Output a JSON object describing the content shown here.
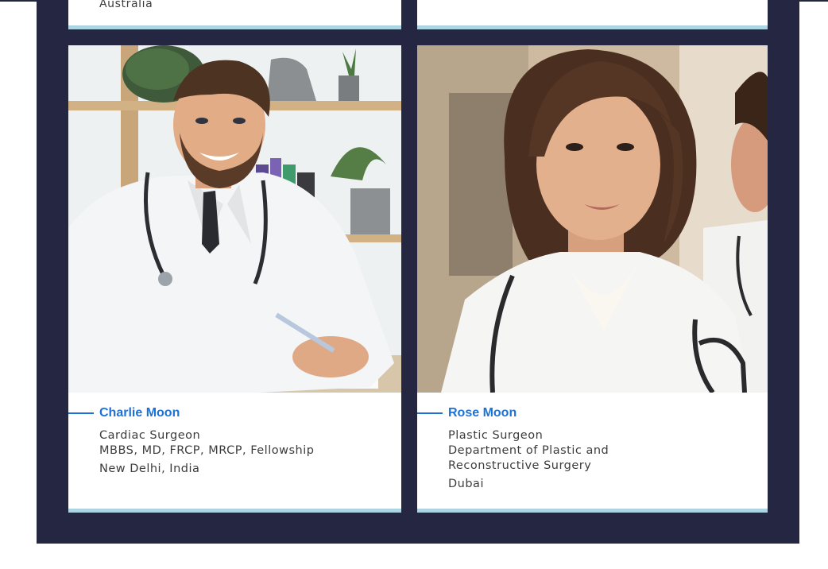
{
  "previous_row": {
    "left_location": "Australia"
  },
  "doctors": [
    {
      "name": "Charlie Moon",
      "specialty": "Cardiac Surgeon",
      "qualifications": "MBBS, MD, FRCP, MRCP, Fellowship",
      "location": "New Delhi, India",
      "photo_icon": "doctor-photo-male"
    },
    {
      "name": "Rose Moon",
      "specialty": "Plastic Surgeon",
      "department_line1": "Department of Plastic and",
      "department_line2": "Reconstructive Surgery",
      "location": "Dubai",
      "photo_icon": "doctor-photo-female"
    }
  ],
  "colors": {
    "panel_bg": "#242642",
    "card_bg": "#ffffff",
    "card_accent": "#add4e2",
    "name_color": "#1b72d8",
    "body_text": "#3c3c3c"
  }
}
